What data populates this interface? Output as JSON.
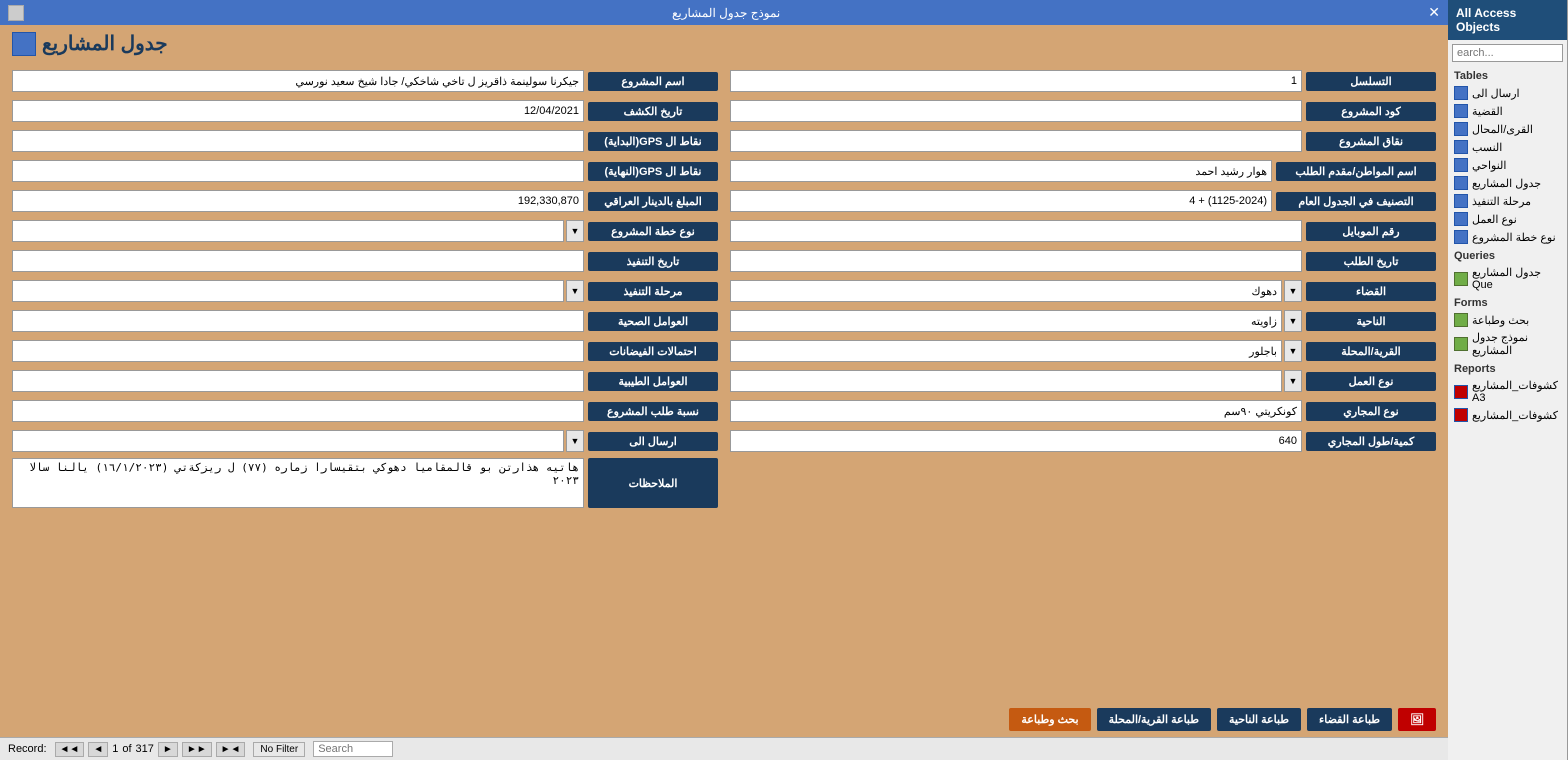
{
  "sidebar": {
    "title": "All Access Objects",
    "search_placeholder": "earch...",
    "sections": {
      "tables": {
        "label": "Tables",
        "items": [
          {
            "label": "ارسال الى",
            "type": "table"
          },
          {
            "label": "القضية",
            "type": "table"
          },
          {
            "label": "القرى/المحال",
            "type": "table"
          },
          {
            "label": "النسب",
            "type": "table"
          },
          {
            "label": "النواحي",
            "type": "table"
          },
          {
            "label": "جدول المشاريع",
            "type": "table"
          },
          {
            "label": "مرحلة التنفيذ",
            "type": "table"
          },
          {
            "label": "نوع العمل",
            "type": "table"
          },
          {
            "label": "نوع خطة المشروع",
            "type": "table"
          }
        ]
      },
      "queries": {
        "label": "Queries",
        "items": [
          {
            "label": "جدول المشاريع Que",
            "type": "query"
          }
        ]
      },
      "forms": {
        "label": "Forms",
        "items": [
          {
            "label": "بحث وطباعة",
            "type": "form"
          },
          {
            "label": "نموذج جدول المشاريع",
            "type": "form"
          }
        ]
      },
      "reports": {
        "label": "Reports",
        "items": [
          {
            "label": "كشوفات_المشاريع A3",
            "type": "report"
          },
          {
            "label": "كشوفات_المشاريع",
            "type": "report"
          }
        ]
      }
    }
  },
  "titlebar": {
    "text": "نموذج جدول المشاريع",
    "close": "✕"
  },
  "form": {
    "title": "جدول المشاريع",
    "fields_right": {
      "serial": {
        "label": "التسلسل",
        "value": "1"
      },
      "project_code": {
        "label": "كود المشروع",
        "value": ""
      },
      "project_points": {
        "label": "نقاق المشروع",
        "value": ""
      },
      "citizen_name": {
        "label": "اسم المواطن/مقدم الطلب",
        "value": "هوار رشيد احمد"
      },
      "classification": {
        "label": "التصنيف في الجدول العام",
        "value": "(1125-2024) + 4"
      },
      "mobile": {
        "label": "رقم الموبايل",
        "value": ""
      },
      "request_date": {
        "label": "تاريخ الطلب",
        "value": ""
      },
      "district": {
        "label": "القضاء",
        "value": "دهوك"
      },
      "sub_district": {
        "label": "الناحية",
        "value": "زاويته"
      },
      "village": {
        "label": "القرية/المحلة",
        "value": "باجلور"
      },
      "work_type": {
        "label": "نوع العمل",
        "value": ""
      },
      "drain_type": {
        "label": "نوع المجاري",
        "value": "كونكريتي ٩٠سم"
      },
      "quantity": {
        "label": "كمية/طول المجاري",
        "value": "640"
      }
    },
    "fields_left": {
      "project_name": {
        "label": "اسم المشروع",
        "value": "جيكرنا سولينمة ذاقريز ل تاخي شاخكي/ جادا شيخ سعيد نورسي"
      },
      "discovery_date": {
        "label": "تاريخ الكشف",
        "value": "12/04/2021"
      },
      "gps_start": {
        "label": "نقاط ال GPS(البداية)",
        "value": ""
      },
      "gps_end": {
        "label": "نقاط ال GPS(النهاية)",
        "value": ""
      },
      "amount": {
        "label": "المبلغ بالدينار العراقي",
        "value": "192,330,870"
      },
      "plan_type": {
        "label": "نوع خطة المشروع",
        "value": ""
      },
      "exec_date": {
        "label": "تاريخ التنفيذ",
        "value": ""
      },
      "exec_stage": {
        "label": "مرحلة التنفيذ",
        "value": ""
      },
      "health_factors": {
        "label": "العوامل الصحية",
        "value": ""
      },
      "flood_prob": {
        "label": "احتمالات الفيضانات",
        "value": ""
      },
      "natural_factors": {
        "label": "العوامل الطيبية",
        "value": ""
      },
      "project_request_pct": {
        "label": "نسبة طلب المشروع",
        "value": ""
      },
      "send_to": {
        "label": "ارسال الى",
        "value": ""
      },
      "notes": {
        "label": "الملاحظات",
        "value": "هاتيه هذارتن بو قالمقاميا دهوكي بتقيسارا زماره (٧٧) ل ريزكةتي (١٦/١/٢٠٢٣) يالنا سالا ٢٠٢٣"
      }
    },
    "buttons": {
      "delete": "🖼",
      "print_district": "طباعة القضاء",
      "print_sub": "طباعة الناحية",
      "print_village": "طباعة القرية/المحلة",
      "search_print": "بحث وطباعة"
    },
    "statusbar": {
      "record_label": "Record:",
      "first": "◄◄",
      "prev": "◄",
      "current": "1",
      "of": "of",
      "total": "317",
      "next": "►",
      "last": "►►",
      "new": "►◄",
      "no_filter": "No Filter",
      "search": "Search"
    }
  }
}
